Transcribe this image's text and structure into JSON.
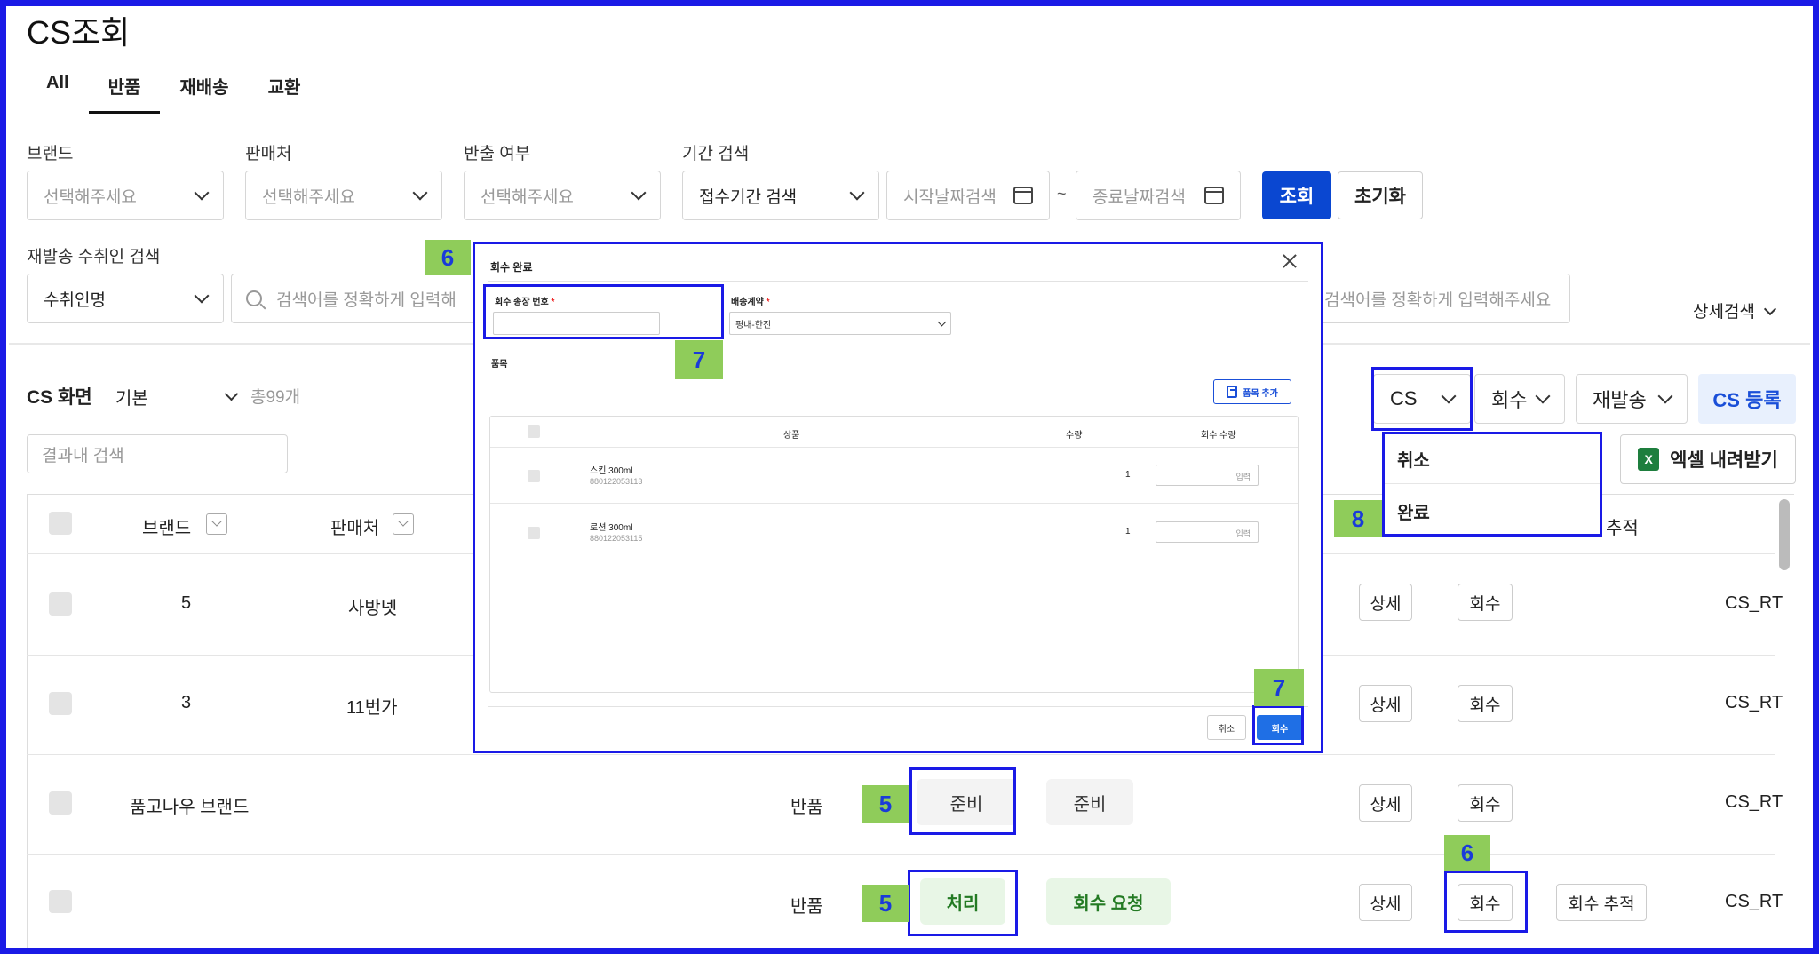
{
  "page": {
    "title": "CS조회"
  },
  "tabs": [
    {
      "label": "All"
    },
    {
      "label": "반품"
    },
    {
      "label": "재배송"
    },
    {
      "label": "교환"
    }
  ],
  "filters": {
    "brand": {
      "label": "브랜드",
      "placeholder": "선택해주세요"
    },
    "seller": {
      "label": "판매처",
      "placeholder": "선택해주세요"
    },
    "shipout": {
      "label": "반출 여부",
      "placeholder": "선택해주세요"
    },
    "period": {
      "label": "기간 검색",
      "type_value": "접수기간 검색",
      "start_placeholder": "시작날짜검색",
      "end_placeholder": "종료날짜검색",
      "separator": "~"
    },
    "search_button": "조회",
    "reset_button": "초기화",
    "recipient": {
      "label": "재발송 수취인 검색",
      "type_value": "수취인명",
      "search_placeholder": "검색어를 정확하게 입력해",
      "search_placeholder_right": "검색어를 정확하게 입력해주세요"
    },
    "detail_search": "상세검색"
  },
  "list": {
    "screen_label": "CS 화면",
    "view_value": "기본",
    "total": "총99개",
    "result_search_placeholder": "결과내 검색",
    "actions": {
      "cs": "CS",
      "collect": "회수",
      "resend": "재발송",
      "register": "CS 등록",
      "excel": "엑셀 내려받기"
    },
    "cs_menu": [
      {
        "label": "취소"
      },
      {
        "label": "완료"
      }
    ],
    "headers": {
      "brand": "브랜드",
      "seller": "판매처",
      "tracking": "추적"
    },
    "rows": [
      {
        "brand": "5",
        "seller": "사방넷",
        "detail": "상세",
        "collect": "회수",
        "id": "CS_RT"
      },
      {
        "brand": "3",
        "seller": "11번가",
        "detail": "상세",
        "collect": "회수",
        "id": "CS_RT"
      },
      {
        "brand": "품고나우 브랜드",
        "type": "반품",
        "status1": "준비",
        "status2": "준비",
        "detail": "상세",
        "collect": "회수",
        "id": "CS_RT"
      },
      {
        "type": "반품",
        "status1": "처리",
        "status2": "회수 요청",
        "detail": "상세",
        "collect": "회수",
        "track": "회수 추적",
        "id": "CS_RT"
      }
    ]
  },
  "modal": {
    "title": "회수 완료",
    "invoice_label": "회수 송장 번호",
    "contract_label": "배송계약",
    "contract_value": "평내-한진",
    "items_label": "품목",
    "add_item": "품목 추가",
    "columns": {
      "product": "상품",
      "qty": "수량",
      "collect_qty": "회수 수량"
    },
    "items": [
      {
        "name": "스킨 300ml",
        "code": "880122053113",
        "qty": "1",
        "input_placeholder": "입력"
      },
      {
        "name": "로션 300ml",
        "code": "880122053115",
        "qty": "1",
        "input_placeholder": "입력"
      }
    ],
    "cancel": "취소",
    "confirm": "회수"
  },
  "annotations": [
    "6",
    "7",
    "7",
    "8",
    "5",
    "5",
    "6"
  ],
  "colors": {
    "primary": "#0a47d1",
    "annotation_border": "#1a1ae6",
    "annotation_bg": "#8fcc5a",
    "green_status": "#237a23"
  }
}
